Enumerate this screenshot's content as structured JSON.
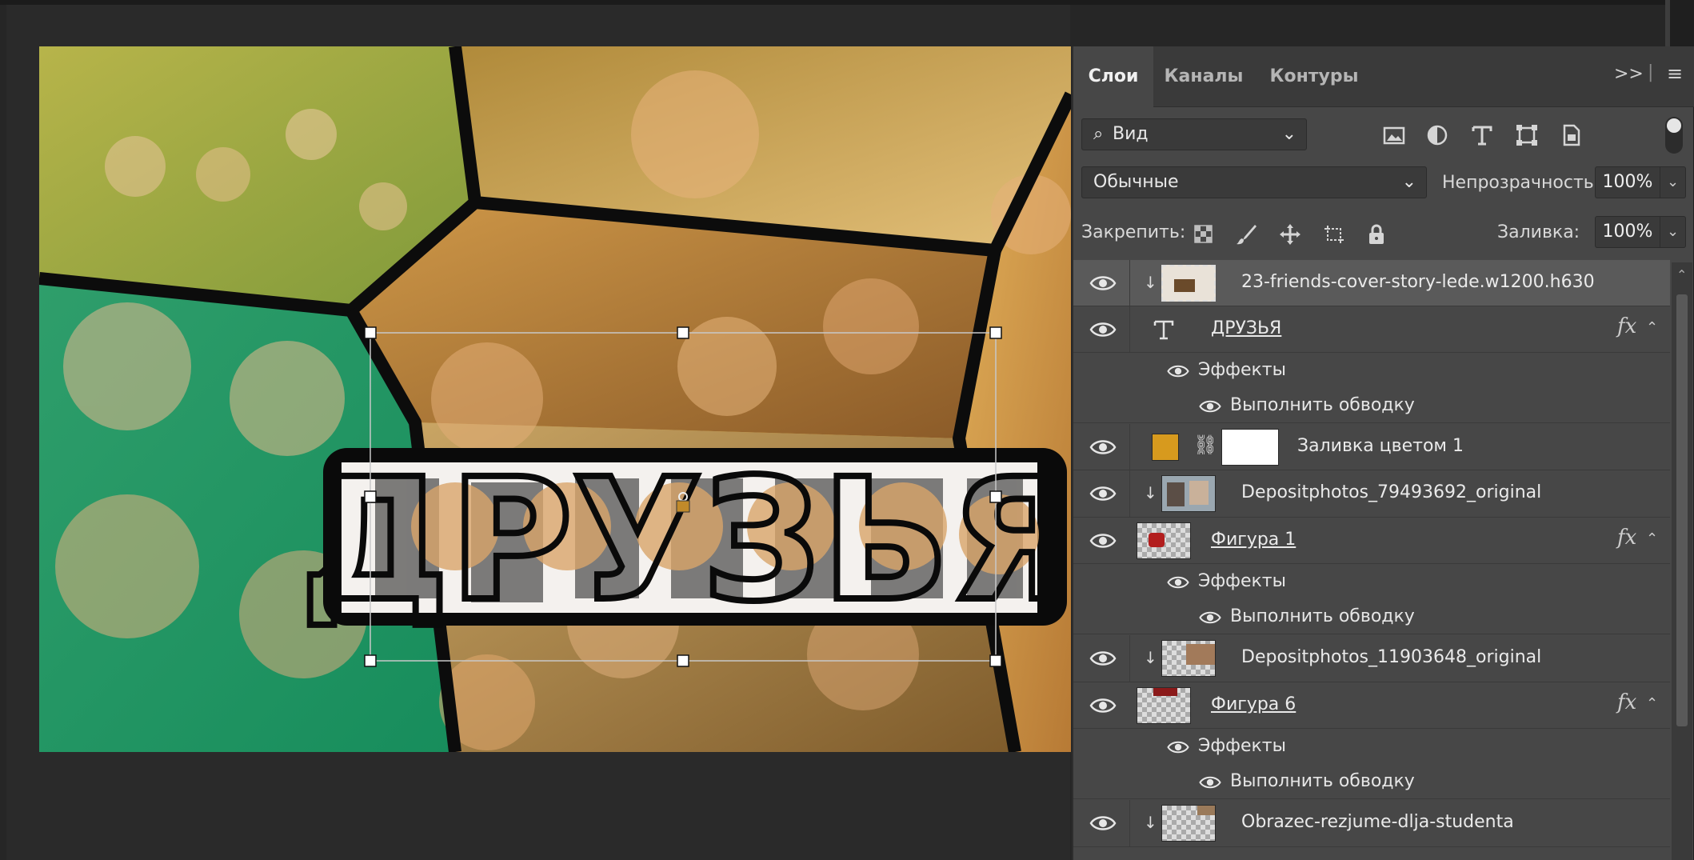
{
  "tabs": [
    "Слои",
    "Каналы",
    "Контуры"
  ],
  "panel_menu": {
    "expand": ">>",
    "menu": "≡"
  },
  "filter": {
    "kind": "Вид"
  },
  "blend_mode": "Обычные",
  "opacity": {
    "label": "Непрозрачность:",
    "value": "100%"
  },
  "lock": {
    "label": "Закрепить:"
  },
  "fill": {
    "label": "Заливка:",
    "value": "100%"
  },
  "canvas": {
    "text_art": "ДРУЗЬЯ"
  },
  "layers": [
    {
      "name": "23-friends-cover-story-lede.w1200.h630"
    },
    {
      "name": "ДРУЗЬЯ",
      "fx": "fx",
      "effects": "Эффекты",
      "effect": "Выполнить обводку"
    },
    {
      "name": "Заливка цветом 1",
      "color": "#d79a1e"
    },
    {
      "name": "Depositphotos_79493692_original"
    },
    {
      "name": "Фигура 1",
      "fx": "fx",
      "effects": "Эффекты",
      "effect": "Выполнить обводку"
    },
    {
      "name": "Depositphotos_11903648_original"
    },
    {
      "name": "Фигура 6",
      "fx": "fx",
      "effects": "Эффекты",
      "effect": "Выполнить обводку"
    },
    {
      "name": "Obrazec-rezjume-dlja-studenta"
    }
  ]
}
